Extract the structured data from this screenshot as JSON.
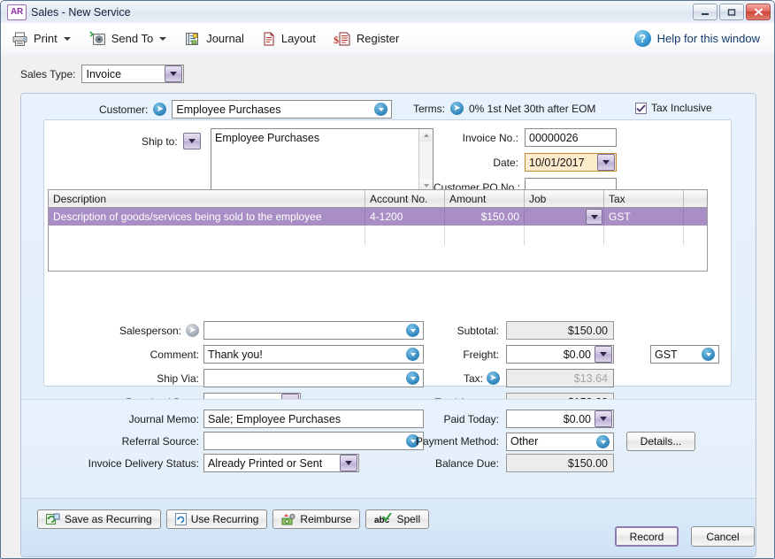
{
  "window": {
    "app_badge": "AR",
    "title": "Sales - New Service",
    "controls": {
      "minimize": "minimize-button",
      "maximize": "maximize-button",
      "close": "close-button"
    }
  },
  "toolbar": {
    "items": [
      {
        "label": "Print",
        "icon": "printer-icon",
        "has_caret": true
      },
      {
        "label": "Send To",
        "icon": "send-to-icon",
        "has_caret": true
      },
      {
        "label": "Journal",
        "icon": "journal-icon",
        "has_caret": false
      },
      {
        "label": "Layout",
        "icon": "layout-icon",
        "has_caret": false
      },
      {
        "label": "Register",
        "icon": "register-icon",
        "has_caret": false
      }
    ],
    "help": {
      "label": "Help for this window",
      "icon": "help-icon",
      "glyph": "?"
    }
  },
  "sales_type": {
    "label": "Sales Type:",
    "value": "Invoice"
  },
  "header": {
    "customer_label": "Customer:",
    "customer_value": "Employee Purchases",
    "terms_label": "Terms:",
    "terms_value": "0% 1st Net 30th after EOM",
    "tax_inclusive_label": "Tax Inclusive",
    "tax_inclusive_checked": true,
    "ship_to_label": "Ship to:",
    "ship_to_value": "Employee Purchases",
    "invoice_no_label": "Invoice No.:",
    "invoice_no_value": "00000026",
    "date_label": "Date:",
    "date_value": "10/01/2017",
    "customer_po_label": "Customer PO No.:",
    "customer_po_value": ""
  },
  "grid": {
    "columns": [
      "Description",
      "Account No.",
      "Amount",
      "Job",
      "Tax"
    ],
    "rows": [
      {
        "description": "Description of goods/services being sold to the employee",
        "account_no": "4-1200",
        "amount": "$150.00",
        "job": "",
        "tax": "GST",
        "selected": true
      }
    ]
  },
  "details": {
    "salesperson_label": "Salesperson:",
    "salesperson_value": "",
    "comment_label": "Comment:",
    "comment_value": "Thank you!",
    "ship_via_label": "Ship Via:",
    "ship_via_value": "",
    "promised_date_label": "Promised Date:",
    "promised_date_value": ""
  },
  "totals": {
    "subtotal_label": "Subtotal:",
    "subtotal_value": "$150.00",
    "freight_label": "Freight:",
    "freight_value": "$0.00",
    "tax_label": "Tax:",
    "tax_value": "$13.64",
    "total_label": "Total Amount:",
    "total_value": "$150.00",
    "tax_code_value": "GST"
  },
  "payment": {
    "journal_memo_label": "Journal Memo:",
    "journal_memo_value": "Sale; Employee Purchases",
    "referral_label": "Referral Source:",
    "referral_value": "",
    "delivery_status_label": "Invoice Delivery Status:",
    "delivery_status_value": "Already Printed or Sent",
    "paid_today_label": "Paid Today:",
    "paid_today_value": "$0.00",
    "payment_method_label": "Payment Method:",
    "payment_method_value": "Other",
    "details_button": "Details...",
    "balance_due_label": "Balance Due:",
    "balance_due_value": "$150.00"
  },
  "action_buttons": [
    {
      "label": "Save as Recurring",
      "icon": "save-recurring-icon"
    },
    {
      "label": "Use Recurring",
      "icon": "use-recurring-icon"
    },
    {
      "label": "Reimburse",
      "icon": "reimburse-icon"
    },
    {
      "label": "Spell",
      "icon": "spell-check-icon"
    }
  ],
  "footer": {
    "record": "Record",
    "cancel": "Cancel"
  },
  "colors": {
    "selection_purple": "#a98ec6",
    "panel_blue": "#e8f2fc",
    "footer_blue": "#dcebf9",
    "accent_blue": "#3d90c4",
    "date_focus": "#fdeccb"
  }
}
